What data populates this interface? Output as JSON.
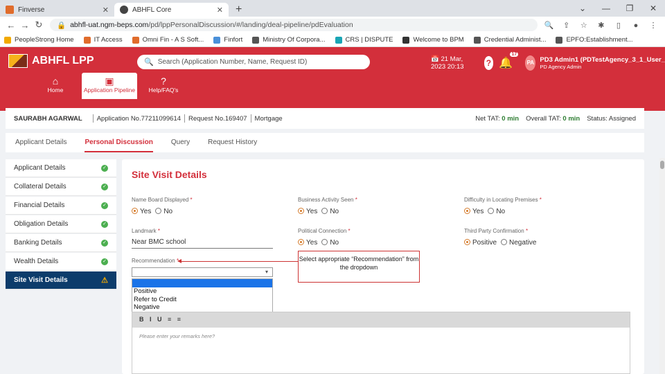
{
  "browser": {
    "tabs": [
      {
        "title": "Finverse",
        "color": "#e06c2c"
      },
      {
        "title": "ABHFL Core",
        "color": "#444444"
      }
    ],
    "url_host": "abhfl-uat.ngm-beps.com",
    "url_path": "/pd/lppPersonalDiscussion/#/landing/deal-pipeline/pdEvaluation",
    "bookmarks": [
      {
        "label": "PeopleStrong Home",
        "color": "#f2a900"
      },
      {
        "label": "IT Access",
        "color": "#e06c2c"
      },
      {
        "label": "Omni Fin - A S Soft...",
        "color": "#e06c2c"
      },
      {
        "label": "Finfort",
        "color": "#4a90d9"
      },
      {
        "label": "Ministry Of Corpora...",
        "color": "#555555"
      },
      {
        "label": "CRS | DISPUTE",
        "color": "#1aa5b5"
      },
      {
        "label": "Welcome to BPM",
        "color": "#333333"
      },
      {
        "label": "Credential Administ...",
        "color": "#555555"
      },
      {
        "label": "EPFO:Establishment...",
        "color": "#555555"
      }
    ]
  },
  "app": {
    "logo_text": "ABHFL LPP",
    "search_placeholder": "Search (Application Number, Name, Request ID)",
    "datetime": "21 Mar, 2023 20:13",
    "notification_count": "17",
    "avatar_initials": "PA",
    "user_name": "PD3 Admin1 (PDTestAgency_3_1_User_",
    "user_role": "PD Agency Admin",
    "nav": [
      {
        "label": "Home"
      },
      {
        "label": "Application Pipeline"
      },
      {
        "label": "Help/FAQ's"
      }
    ]
  },
  "application": {
    "customer": "SAURABH AGARWAL",
    "app_no": "Application No.77211099614",
    "request_no": "Request No.169407",
    "product": "Mortgage",
    "net_tat_label": "Net TAT:",
    "net_tat": "0 min",
    "overall_tat_label": "Overall TAT:",
    "overall_tat": "0 min",
    "status": "Status: Assigned"
  },
  "tabs": [
    "Applicant Details",
    "Personal Discussion",
    "Query",
    "Request History"
  ],
  "side_menu": [
    {
      "label": "Applicant Details",
      "state": "done"
    },
    {
      "label": "Collateral Details",
      "state": "done"
    },
    {
      "label": "Financial Details",
      "state": "done"
    },
    {
      "label": "Obligation Details",
      "state": "done"
    },
    {
      "label": "Banking Details",
      "state": "done"
    },
    {
      "label": "Wealth Details",
      "state": "done"
    },
    {
      "label": "Site Visit Details",
      "state": "warning"
    }
  ],
  "form": {
    "title": "Site Visit Details",
    "name_board_label": "Name Board Displayed",
    "business_activity_label": "Business Activity Seen",
    "difficulty_label": "Difficulty in Locating Premises",
    "landmark_label": "Landmark",
    "landmark_value": "Near BMC school",
    "political_label": "Political Connection",
    "third_party_label": "Third Party Confirmation",
    "recommendation_label": "Recommendation",
    "yes": "Yes",
    "no": "No",
    "positive": "Positive",
    "negative": "Negative",
    "required_mark": "*",
    "dropdown_options": [
      "Positive",
      "Refer to Credit",
      "Negative"
    ],
    "remarks_placeholder": "Please enter your remarks here?",
    "editor_toolbar": "B I U ≡ ≡"
  },
  "callout": "Select appropriate “Recommendation” from the dropdown"
}
